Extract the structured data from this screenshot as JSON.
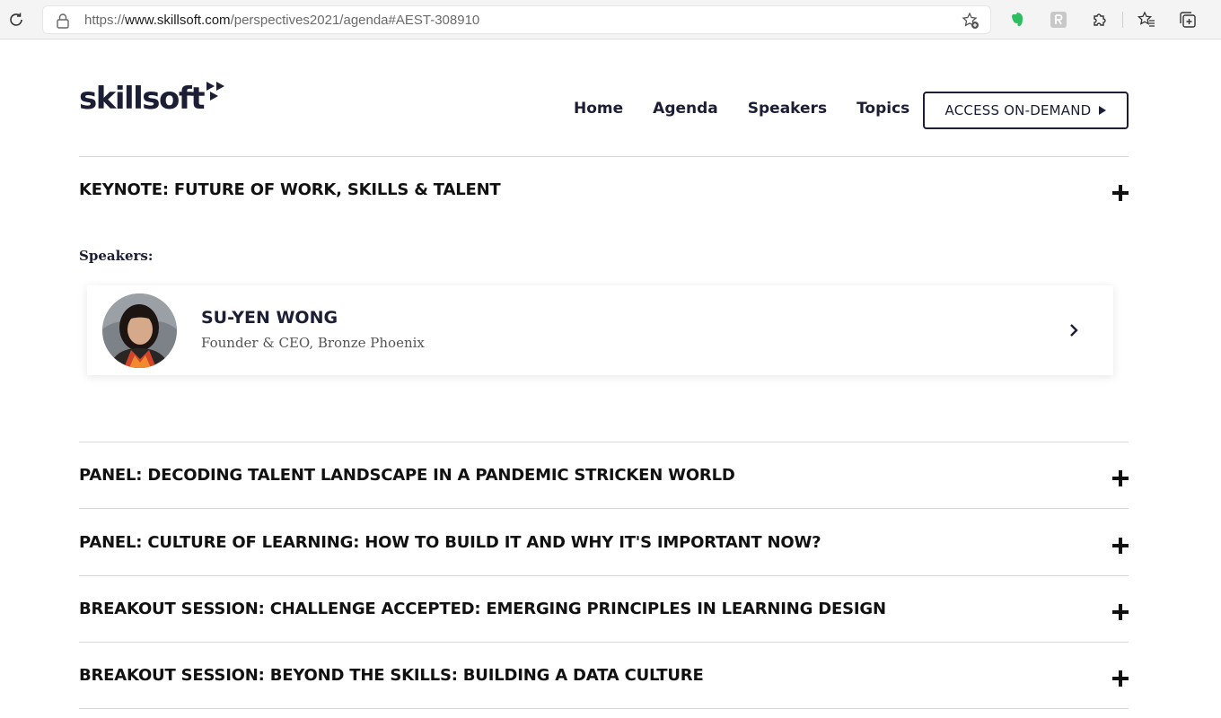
{
  "browser": {
    "url_prefix": "https://",
    "url_domain": "www.skillsoft.com",
    "url_path": "/perspectives2021/agenda#AEST-308910"
  },
  "header": {
    "logo_text": "skillsoft",
    "nav": [
      "Home",
      "Agenda",
      "Speakers",
      "Topics"
    ],
    "cta_label": "ACCESS ON-DEMAND"
  },
  "sessions": [
    {
      "title": "KEYNOTE: FUTURE OF WORK, SKILLS & TALENT"
    },
    {
      "title": "PANEL: DECODING TALENT LANDSCAPE IN A PANDEMIC STRICKEN WORLD"
    },
    {
      "title": "PANEL: CULTURE OF LEARNING: HOW TO BUILD IT AND WHY IT'S IMPORTANT NOW?"
    },
    {
      "title": "BREAKOUT SESSION: CHALLENGE ACCEPTED: EMERGING PRINCIPLES IN LEARNING DESIGN"
    },
    {
      "title": "BREAKOUT SESSION: BEYOND THE SKILLS: BUILDING A DATA CULTURE"
    }
  ],
  "keynote_detail": {
    "speakers_label": "Speakers:",
    "speaker": {
      "name": "SU-YEN WONG",
      "role": "Founder & CEO, Bronze Phoenix"
    }
  },
  "colors": {
    "brand_navy": "#1b1e35",
    "evernote_green": "#2dbe60"
  },
  "icons": [
    "reload-icon",
    "lock-icon",
    "star-add-icon",
    "evernote-icon",
    "extension-r-icon",
    "puzzle-icon",
    "favorites-icon",
    "collections-icon",
    "plus-icon",
    "chevron-right-icon",
    "play-arrow-icon"
  ]
}
